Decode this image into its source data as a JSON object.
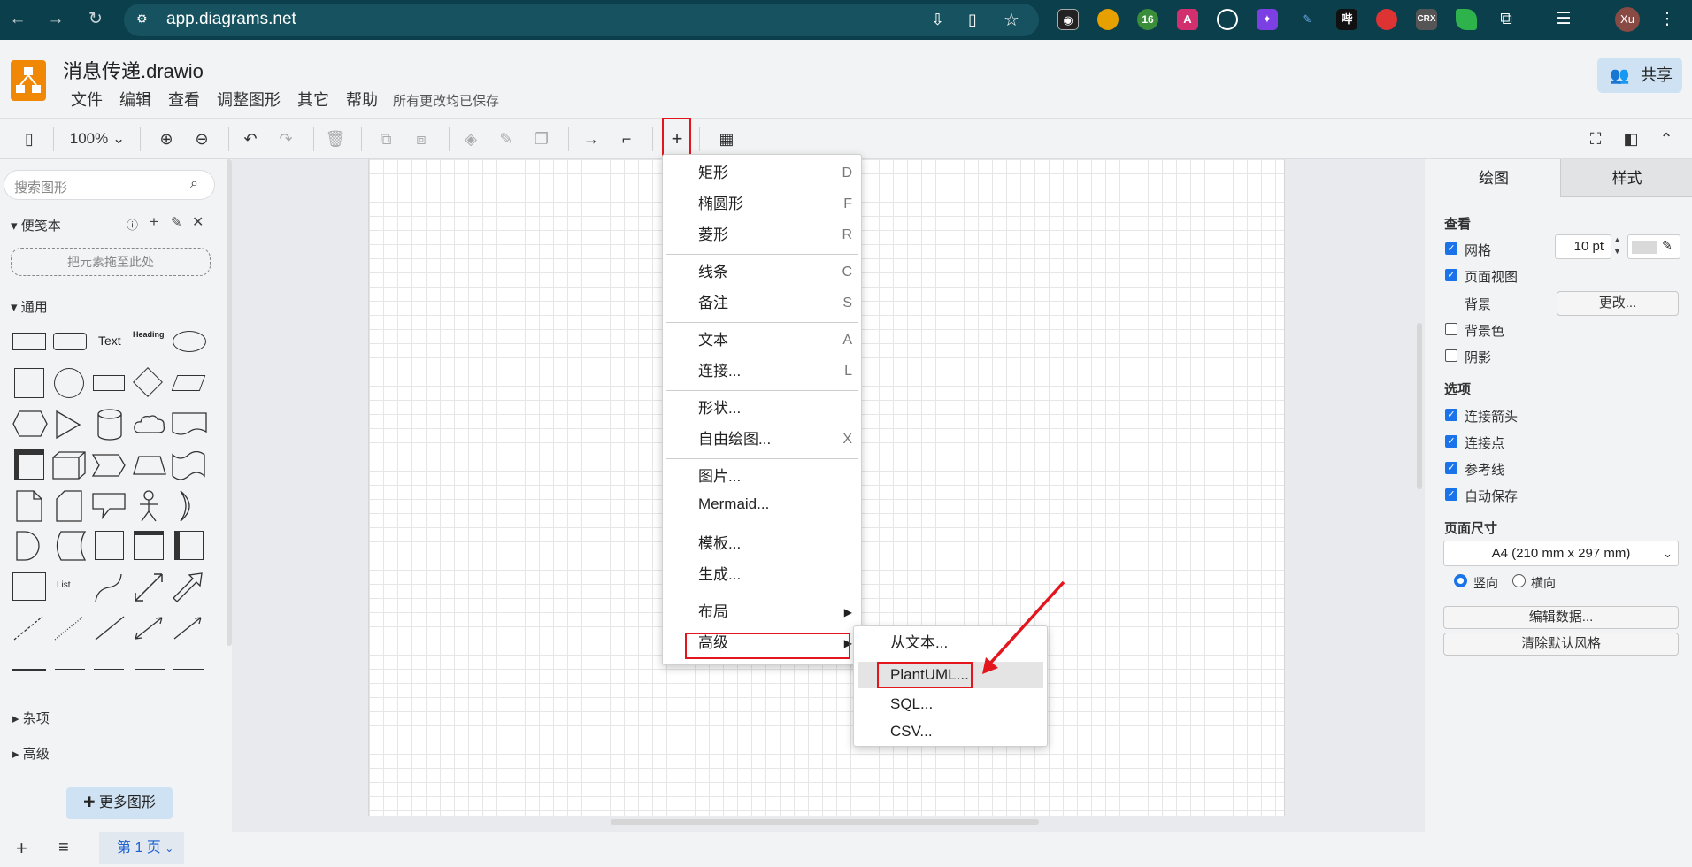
{
  "browser": {
    "url": "app.diagrams.net",
    "avatar": "Xu",
    "ext_badge": "16"
  },
  "app": {
    "title": "消息传递.drawio",
    "saved_status": "所有更改均已保存",
    "share_label": "共享",
    "menus": [
      "文件",
      "编辑",
      "查看",
      "调整图形",
      "其它",
      "帮助"
    ]
  },
  "toolbar": {
    "zoom": "100%"
  },
  "sidebar": {
    "search_placeholder": "搜索图形",
    "scratchpad_title": "便笺本",
    "dropzone": "把元素拖至此处",
    "general_title": "通用",
    "text_shape": "Text",
    "heading_shape": "Heading",
    "list_shape": "List",
    "misc_title": "杂项",
    "advanced_title": "高级",
    "more_shapes": "更多图形"
  },
  "insert_menu": {
    "items": [
      {
        "label": "矩形",
        "key": "D"
      },
      {
        "label": "椭圆形",
        "key": "F"
      },
      {
        "label": "菱形",
        "key": "R"
      },
      {
        "label": "线条",
        "key": "C"
      },
      {
        "label": "备注",
        "key": "S"
      },
      {
        "label": "文本",
        "key": "A"
      },
      {
        "label": "连接...",
        "key": "L"
      },
      {
        "label": "形状...",
        "key": ""
      },
      {
        "label": "自由绘图...",
        "key": "X"
      },
      {
        "label": "图片...",
        "key": ""
      },
      {
        "label": "Mermaid...",
        "key": ""
      },
      {
        "label": "模板...",
        "key": ""
      },
      {
        "label": "生成...",
        "key": ""
      },
      {
        "label": "布局",
        "key": ""
      },
      {
        "label": "高级",
        "key": ""
      }
    ]
  },
  "advanced_submenu": {
    "items": [
      "从文本...",
      "PlantUML...",
      "SQL...",
      "CSV..."
    ]
  },
  "format_panel": {
    "tab_diagram": "绘图",
    "tab_style": "样式",
    "view_title": "查看",
    "grid": "网格",
    "grid_size": "10 pt",
    "page_view": "页面视图",
    "background": "背景",
    "change_button": "更改...",
    "background_color": "背景色",
    "shadow": "阴影",
    "options_title": "选项",
    "connection_arrows": "连接箭头",
    "connection_points": "连接点",
    "guides": "参考线",
    "autosave": "自动保存",
    "paper_size_title": "页面尺寸",
    "paper_size": "A4 (210 mm x 297 mm)",
    "portrait": "竖向",
    "landscape": "横向",
    "edit_data": "编辑数据...",
    "clear_style": "清除默认风格"
  },
  "pages": {
    "current": "第 1 页"
  },
  "colors": {
    "accent_red": "#e3161d",
    "logo_orange": "#f08705",
    "chrome_bg": "#0c3f4c"
  }
}
